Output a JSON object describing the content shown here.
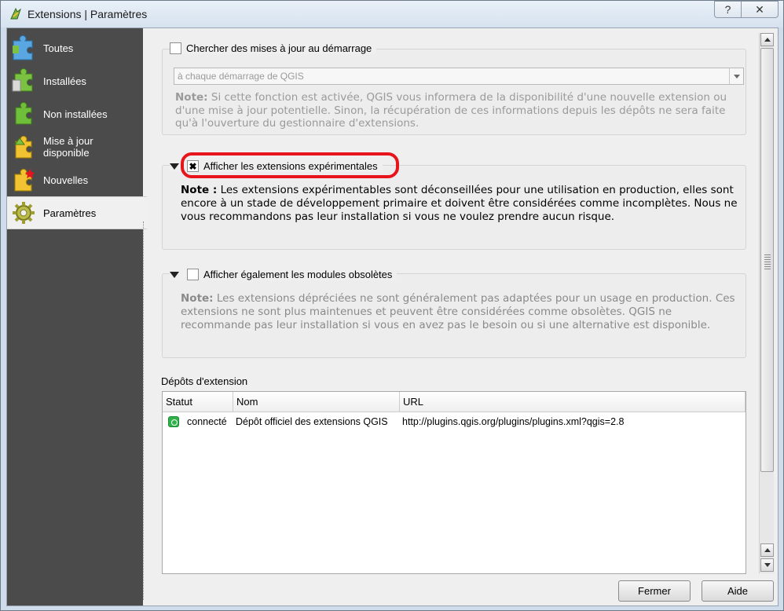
{
  "window": {
    "title": "Extensions | Paramètres",
    "help_glyph": "?",
    "close_glyph": "✕"
  },
  "sidebar": {
    "items": [
      {
        "label": "Toutes",
        "icon": "puzzle-all-icon"
      },
      {
        "label": "Installées",
        "icon": "puzzle-installed-icon"
      },
      {
        "label": "Non installées",
        "icon": "puzzle-not-installed-icon"
      },
      {
        "label": "Mise à jour\ndisponible",
        "icon": "puzzle-upgrade-icon"
      },
      {
        "label": "Nouvelles",
        "icon": "puzzle-new-icon"
      },
      {
        "label": "Paramètres",
        "icon": "gear-icon"
      }
    ],
    "active_index": 5
  },
  "settings": {
    "check_updates": {
      "label": "Chercher des mises à jour au démarrage",
      "checked": false,
      "frequency_value": "à chaque démarrage de QGIS",
      "note_prefix": "Note:",
      "note_text": " Si cette fonction est activée, QGIS vous informera de la disponibilité d'une nouvelle extension ou d'une mise à jour potentielle. Sinon, la récupération de ces informations depuis les dépôts ne sera faite qu'à l'ouverture du gestionnaire d'extensions."
    },
    "experimental": {
      "label": "Afficher les extensions expérimentales",
      "checked": true,
      "check_glyph": "✖",
      "note_prefix": "Note :",
      "note_text": " Les extensions expérimentables sont déconseillées pour une utilisation en production, elles sont encore à un stade de développement primaire et doivent être considérées comme incomplètes. Nous ne vous recommandons pas leur installation si vous ne voulez prendre aucun risque."
    },
    "deprecated": {
      "label": "Afficher également les modules obsolètes",
      "checked": false,
      "note_prefix": "Note:",
      "note_text": " Les extensions dépréciées ne sont généralement pas adaptées pour un usage en production. Ces extensions ne sont plus maintenues et peuvent être considérées comme obsolètes. QGIS ne recommande pas leur installation si vous en avez pas le besoin ou si une alternative est disponible."
    }
  },
  "repositories": {
    "label": "Dépôts d'extension",
    "columns": [
      "Statut",
      "Nom",
      "URL"
    ],
    "rows": [
      {
        "status": "connecté",
        "name": "Dépôt officiel des extensions QGIS",
        "url": "http://plugins.qgis.org/plugins/plugins.xml?qgis=2.8"
      }
    ]
  },
  "buttons": {
    "close": "Fermer",
    "help": "Aide"
  },
  "colors": {
    "sidebar_bg": "#4b4b4b",
    "highlight_outline": "#e8141b",
    "status_ok": "#2fb24a"
  }
}
